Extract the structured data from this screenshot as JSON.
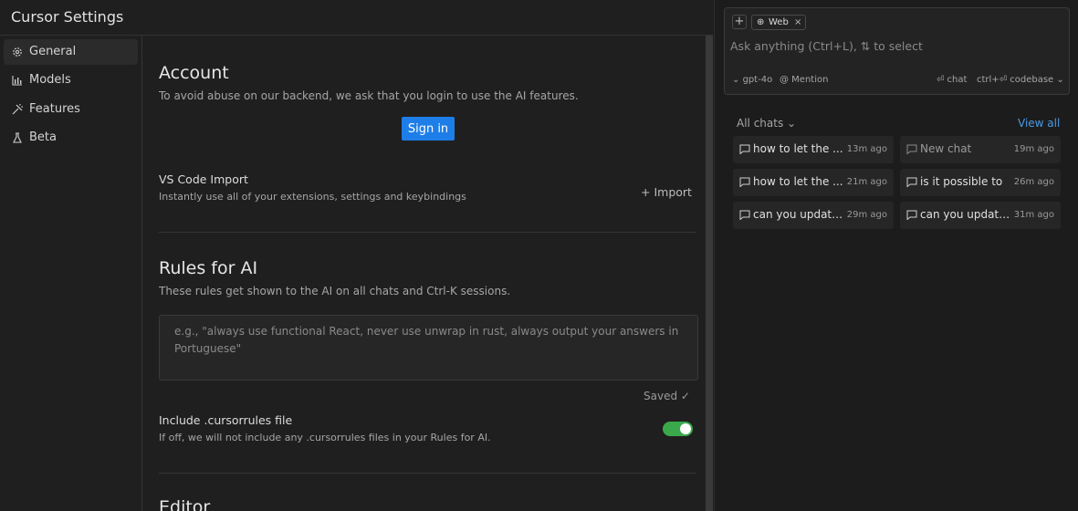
{
  "window": {
    "title": "Cursor Settings"
  },
  "nav": [
    {
      "label": "General",
      "icon": "gear-icon"
    },
    {
      "label": "Models",
      "icon": "bar-chart-icon"
    },
    {
      "label": "Features",
      "icon": "tools-icon"
    },
    {
      "label": "Beta",
      "icon": "flask-icon"
    }
  ],
  "account": {
    "title": "Account",
    "desc": "To avoid abuse on our backend, we ask that you login to use the AI features.",
    "signin_label": "Sign in"
  },
  "vscode_import": {
    "title": "VS Code Import",
    "desc": "Instantly use all of your extensions, settings and keybindings",
    "button_label": "Import"
  },
  "rules": {
    "title": "Rules for AI",
    "desc": "These rules get shown to the AI on all chats and Ctrl-K sessions.",
    "placeholder": "e.g., \"always use functional React, never use unwrap in rust, always output your answers in Portuguese\"",
    "saved_label": "Saved ✓"
  },
  "cursorrules": {
    "title": "Include .cursorrules file",
    "desc": "If off, we will not include any .cursorrules files in your Rules for AI.",
    "enabled": true
  },
  "editor": {
    "title": "Editor"
  },
  "chat": {
    "chip_label": "Web",
    "input_placeholder": "Ask anything (Ctrl+L), ⇅ to select",
    "model_label": "gpt-4o",
    "mention_label": "@ Mention",
    "chat_shortcut": "⏎ chat",
    "codebase_shortcut": "ctrl+⏎ codebase",
    "all_chats_label": "All chats",
    "view_all_label": "View all",
    "history": [
      {
        "title": "how to let the ...",
        "time": "13m ago"
      },
      {
        "title": "New chat",
        "time": "19m ago"
      },
      {
        "title": "how to let the ...",
        "time": "21m ago"
      },
      {
        "title": "is it possible to",
        "time": "26m ago"
      },
      {
        "title": "can you update...",
        "time": "29m ago"
      },
      {
        "title": "can you update...",
        "time": "31m ago"
      }
    ]
  },
  "colors": {
    "accent": "#1e7ee8",
    "toggle_on": "#3aa94b",
    "link": "#4a9be8",
    "background": "#1f1f1f"
  }
}
